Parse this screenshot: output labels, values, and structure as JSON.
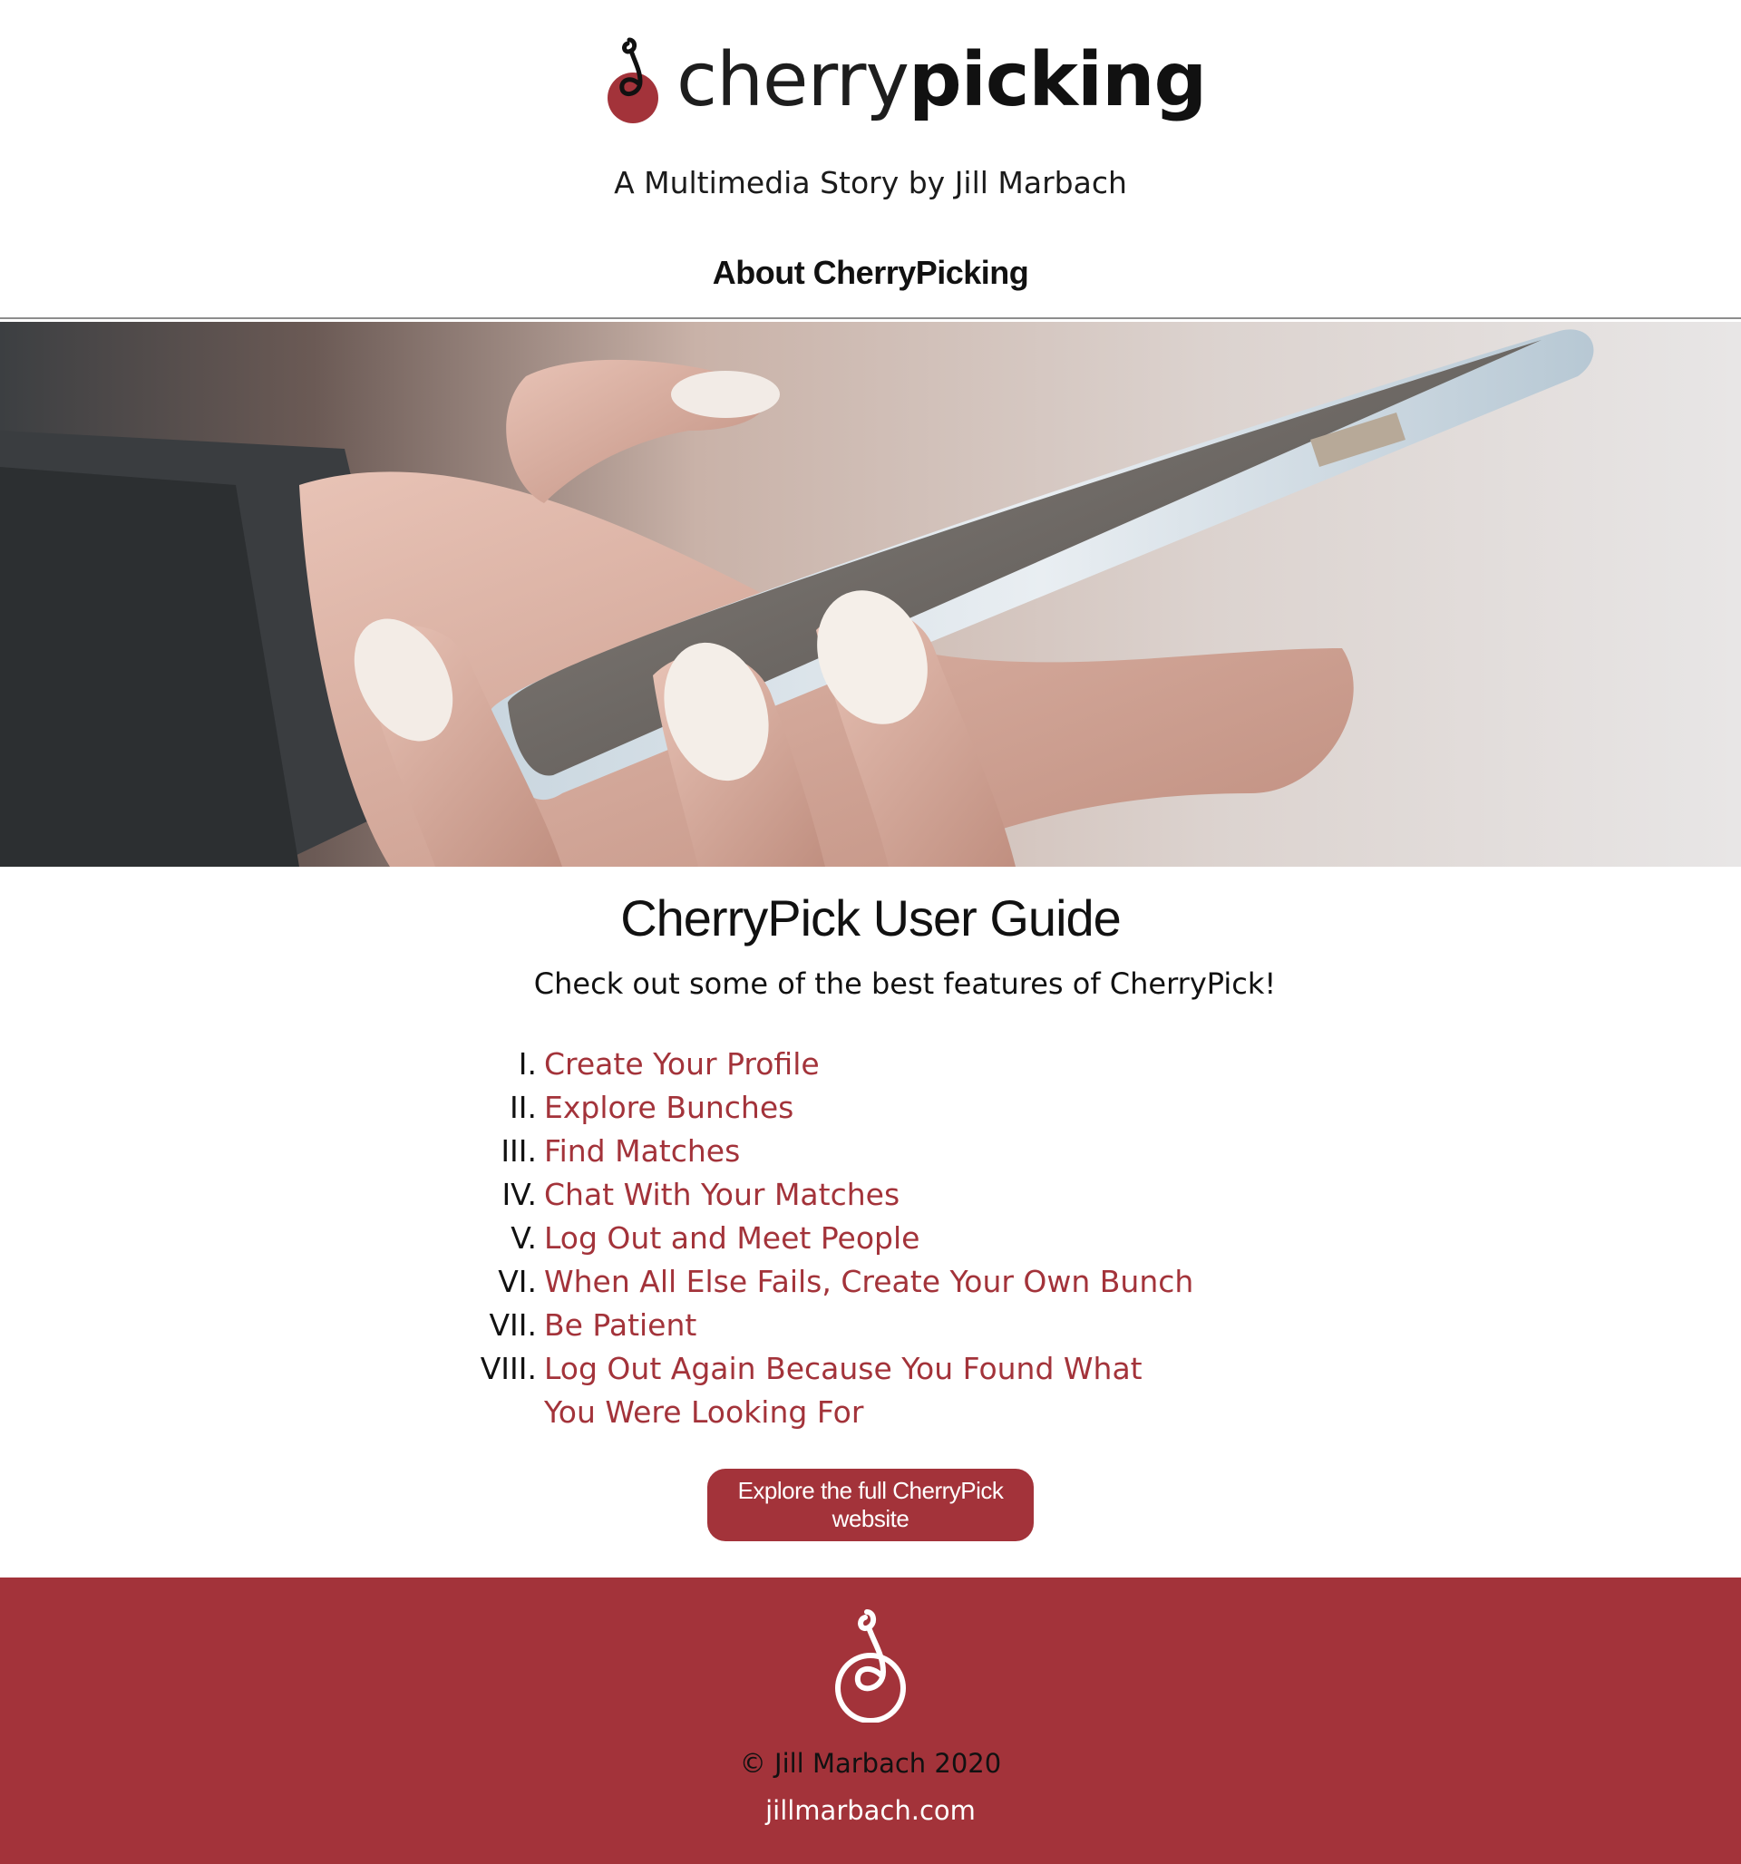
{
  "brand": {
    "name_light": "cherry",
    "name_bold": "picking",
    "byline": "A Multimedia Story by Jill Marbach",
    "primary_color": "#a3333a"
  },
  "nav": {
    "about_label": "About CherryPicking"
  },
  "hero": {
    "image_icon": "hand-holding-phone-image"
  },
  "guide": {
    "title": "CherryPick User Guide",
    "subtitle": "Check out some of the best features of CherryPick!",
    "items": [
      {
        "num": "I.",
        "label": "Create Your Profile"
      },
      {
        "num": "II.",
        "label": "Explore Bunches"
      },
      {
        "num": "III.",
        "label": "Find Matches"
      },
      {
        "num": "IV.",
        "label": "Chat With Your Matches"
      },
      {
        "num": "V.",
        "label": "Log Out and Meet People"
      },
      {
        "num": "VI.",
        "label": "When All Else Fails, Create Your Own Bunch"
      },
      {
        "num": "VII.",
        "label": "Be Patient"
      },
      {
        "num": "VIII.",
        "label": "Log Out Again Because You Found What You Were Looking For"
      }
    ],
    "cta_label": "Explore the full CherryPick website"
  },
  "footer": {
    "logo_icon": "cherry-logo-icon",
    "copyright": "© Jill Marbach 2020",
    "site": "jillmarbach.com"
  }
}
